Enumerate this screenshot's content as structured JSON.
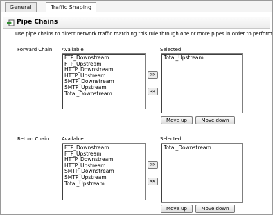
{
  "tabs": [
    {
      "label": "General"
    },
    {
      "label": "Traffic Shaping"
    }
  ],
  "section": {
    "title": "Pipe Chains",
    "icon": "arrow-into-box-icon"
  },
  "description": "Use pipe chains to direct network traffic matching this rule through one or more pipes in order to perform",
  "forward": {
    "chain_label": "Forward Chain",
    "available_label": "Available",
    "selected_label": "Selected",
    "available": [
      "FTP_Downstream",
      "FTP_Upstream",
      "HTTP_Downstream",
      "HTTP_Upstream",
      "SMTP_Downstream",
      "SMTP_Upstream",
      "Total_Downstream"
    ],
    "selected": [
      "Total_Upstream"
    ],
    "add_label": ">>",
    "remove_label": "<<",
    "move_up_label": "Move up",
    "move_down_label": "Move down"
  },
  "return": {
    "chain_label": "Return Chain",
    "available_label": "Available",
    "selected_label": "Selected",
    "available": [
      "FTP_Downstream",
      "FTP_Upstream",
      "HTTP_Downstream",
      "HTTP_Upstream",
      "SMTP_Downstream",
      "SMTP_Upstream",
      "Total_Upstream"
    ],
    "selected": [
      "Total_Downstream"
    ],
    "add_label": ">>",
    "remove_label": "<<",
    "move_up_label": "Move up",
    "move_down_label": "Move down"
  }
}
